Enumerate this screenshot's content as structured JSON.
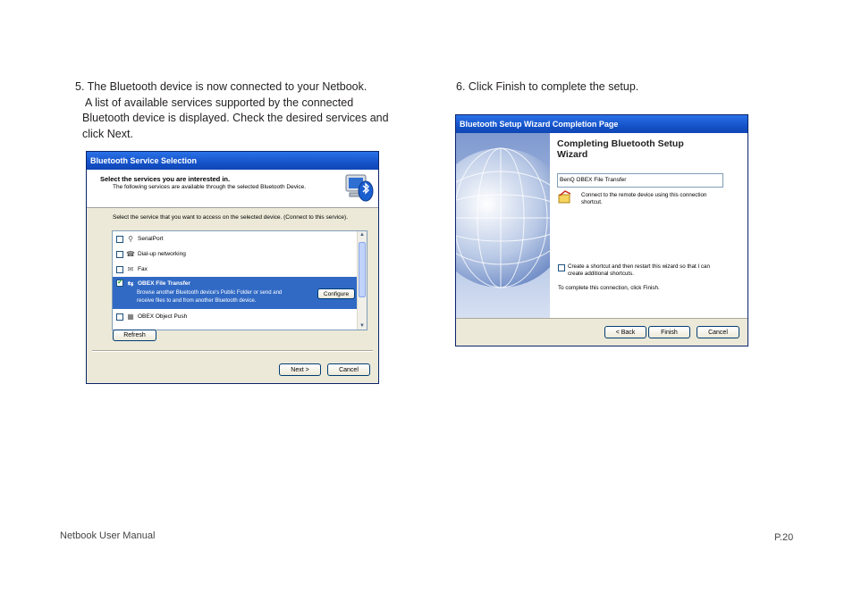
{
  "step5": {
    "lines": [
      "5. The Bluetooth device is now connected to your Netbook.",
      "A list of available services supported by the connected",
      "Bluetooth device is displayed. Check the desired services and",
      "click Next."
    ]
  },
  "step6": {
    "text": "6. Click Finish to complete the setup."
  },
  "dialog1": {
    "title": "Bluetooth Service Selection",
    "header_title": "Select the services you are interested in.",
    "header_subtitle": "The following services are available through the selected Bluetooth Device.",
    "instruction": "Select the service that you want to access on the selected device. (Connect to this service).",
    "services": [
      {
        "label": "SerialPort",
        "checked": false,
        "icon": "serial-port-icon",
        "glyph": "⚲"
      },
      {
        "label": "Dial-up networking",
        "checked": false,
        "icon": "dialup-icon",
        "glyph": "☎"
      },
      {
        "label": "Fax",
        "checked": false,
        "icon": "fax-icon",
        "glyph": "✉"
      },
      {
        "label": "OBEX File Transfer",
        "checked": true,
        "icon": "file-transfer-icon",
        "glyph": "⇆",
        "description_lines": [
          "Browse another Bluetooth device's Public Folder or send and",
          "receive files to and from another Bluetooth device."
        ]
      },
      {
        "label": "OBEX Object Push",
        "checked": false,
        "icon": "object-push-icon",
        "glyph": "▦"
      }
    ],
    "configure_label": "Configure",
    "refresh_label": "Refresh",
    "next_label": "Next >",
    "cancel_label": "Cancel"
  },
  "dialog2": {
    "title": "Bluetooth Setup Wizard Completion Page",
    "heading_lines": [
      "Completing Bluetooth Setup",
      "Wizard"
    ],
    "device_value": "BenQ OBEX File Transfer",
    "connect_lines": [
      "Connect to the remote device using this connection",
      "shortcut."
    ],
    "shortcut_lines": [
      "Create a shortcut and then restart this wizard so that I can",
      "create additional shortcuts."
    ],
    "shortcut_checked": false,
    "finish_note": "To complete this connection, click Finish.",
    "back_label": "< Back",
    "finish_label": "Finish",
    "cancel_label": "Cancel"
  },
  "footer": {
    "left": "Netbook User Manual",
    "right": "P.20"
  },
  "colors": {
    "titlebar": "#1553c9",
    "dialog_bg": "#ece9d8",
    "selection": "#316ac5"
  }
}
